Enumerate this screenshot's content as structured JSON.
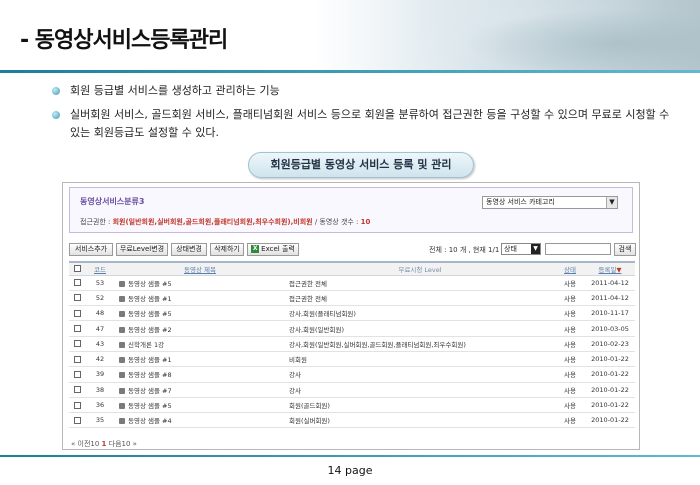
{
  "slide": {
    "title": "- 동영상서비스등록관리",
    "bullets": [
      "회원 등급별 서비스를 생성하고 관리하는 기능",
      "실버회원 서비스, 골드회원 서비스, 플래티넘회원 서비스 등으로 회원을 분류하여 접근권한 등을 구성할 수 있으며 무료로 시청할 수 있는 회원등급도 설정할 수 있다."
    ],
    "caption": "회원등급별 동영상 서비스 등록 및 관리",
    "page": "14 page"
  },
  "panel": {
    "filter": {
      "title": "동영상서비스분류3",
      "select_value": "동영상 서비스 카테고리",
      "access_label": "접근권한 : ",
      "access_levels": "회원(일반회원,실버회원,골드회원,플래티넘회원,최우수회원),비회원",
      "count_label": " / 동영상 갯수 : ",
      "count_value": "10"
    },
    "toolbar": {
      "add": "서비스추가",
      "free_level": "무료Level변경",
      "state_change": "상태변경",
      "delete": "삭제하기",
      "excel_icon": "X",
      "excel": "Excel 출력",
      "total": "전체 : 10 개 , 현재 1/1",
      "state_select": "상태",
      "search": "검색"
    },
    "columns": [
      "",
      "코드",
      "동영상 제목",
      "무료시청 Level",
      "상태",
      "등록일"
    ],
    "sort_marker": "▼",
    "rows": [
      {
        "code": "53",
        "title": "동영상 샘플 #5",
        "level": "접근권한 전체",
        "state": "사용",
        "date": "2011-04-12"
      },
      {
        "code": "52",
        "title": "동영상 샘플 #1",
        "level": "접근권한 전체",
        "state": "사용",
        "date": "2011-04-12"
      },
      {
        "code": "48",
        "title": "동영상 샘플 #5",
        "level": "강사,회원(플래티넘회원)",
        "state": "사용",
        "date": "2010-11-17"
      },
      {
        "code": "47",
        "title": "동영상 샘플 #2",
        "level": "강사,회원(일반회원)",
        "state": "사용",
        "date": "2010-03-05"
      },
      {
        "code": "43",
        "title": "신학개론 1강",
        "level": "강사,회원(일반회원,실버회원,골드회원,플래티넘회원,최우수회원)",
        "state": "사용",
        "date": "2010-02-23"
      },
      {
        "code": "42",
        "title": "동영상 샘플 #1",
        "level": "비회원",
        "state": "사용",
        "date": "2010-01-22"
      },
      {
        "code": "39",
        "title": "동영상 샘플 #8",
        "level": "강사",
        "state": "사용",
        "date": "2010-01-22"
      },
      {
        "code": "38",
        "title": "동영상 샘플 #7",
        "level": "강사",
        "state": "사용",
        "date": "2010-01-22"
      },
      {
        "code": "36",
        "title": "동영상 샘플 #5",
        "level": "회원(골드회원)",
        "state": "사용",
        "date": "2010-01-22"
      },
      {
        "code": "35",
        "title": "동영상 샘플 #4",
        "level": "회원(실버회원)",
        "state": "사용",
        "date": "2010-01-22"
      }
    ],
    "pager": {
      "prev": "« 이전10",
      "current": "1",
      "next": "다음10 »"
    }
  },
  "colors": {
    "accent": "#1b7f9a",
    "link": "#5a7fae",
    "highlight": "#c0392b"
  }
}
